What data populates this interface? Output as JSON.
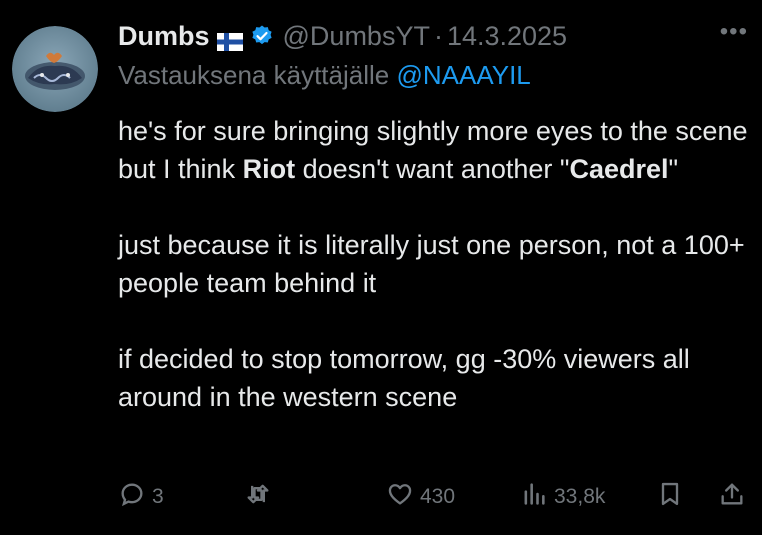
{
  "tweet": {
    "display_name": "Dumbs",
    "handle": "@DumbsYT",
    "separator": "·",
    "date": "14.3.2025",
    "more_label": "•••",
    "reply_prefix": "Vastauksena käyttäjälle ",
    "reply_to": "@NAAAYIL",
    "body": {
      "p1_a": "he's for sure bringing slightly more eyes to the scene but I think ",
      "p1_bold1": "Riot",
      "p1_b": " doesn't want another \"",
      "p1_bold2": "Caedrel",
      "p1_c": "\"",
      "p2": "just because it is literally just one person, not a 100+ people team behind it",
      "p3": "if decided to stop tomorrow, gg -30% viewers all around in the western scene"
    }
  },
  "actions": {
    "replies": "3",
    "reposts": "",
    "likes": "430",
    "views": "33,8k"
  },
  "colors": {
    "background": "#000000",
    "text": "#e7e9ea",
    "muted": "#71767b",
    "link": "#1d9bf0",
    "verified": "#1d9bf0"
  },
  "icons": [
    "avatar-image",
    "finland-flag-icon",
    "verified-badge-icon",
    "more-icon",
    "reply-icon",
    "repost-icon",
    "like-icon",
    "views-icon",
    "bookmark-icon",
    "share-icon"
  ]
}
